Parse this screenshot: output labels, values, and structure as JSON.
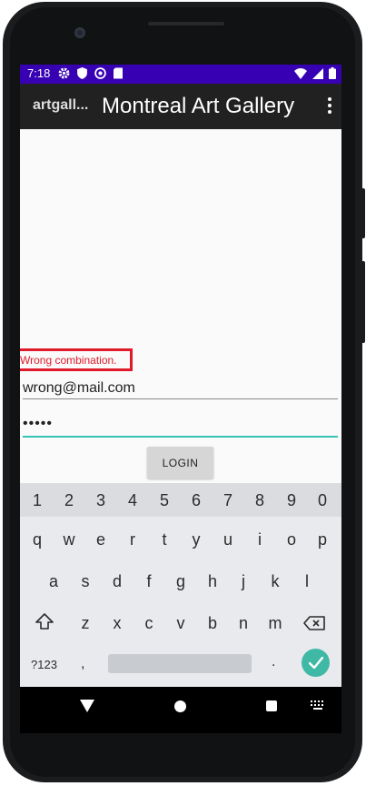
{
  "status_bar": {
    "time": "7:18"
  },
  "app_bar": {
    "app_label": "artgall...",
    "title": "Montreal Art Gallery"
  },
  "form": {
    "error_message": "Wrong combination.",
    "email_value": "wrong@mail.com",
    "password_masked": "•••••",
    "login_label": "LOGIN"
  },
  "keyboard": {
    "number_row": [
      "1",
      "2",
      "3",
      "4",
      "5",
      "6",
      "7",
      "8",
      "9",
      "0"
    ],
    "row1": [
      "q",
      "w",
      "e",
      "r",
      "t",
      "y",
      "u",
      "i",
      "o",
      "p"
    ],
    "row2": [
      "a",
      "s",
      "d",
      "f",
      "g",
      "h",
      "j",
      "k",
      "l"
    ],
    "row3": [
      "z",
      "x",
      "c",
      "v",
      "b",
      "n",
      "m"
    ],
    "symbols_label": "?123",
    "comma": ",",
    "period": "."
  },
  "colors": {
    "status_bar": "#3700b3",
    "app_bar": "#212121",
    "error": "#e01a2b",
    "accent": "#35c4b8",
    "enter": "#3fb9a6"
  }
}
